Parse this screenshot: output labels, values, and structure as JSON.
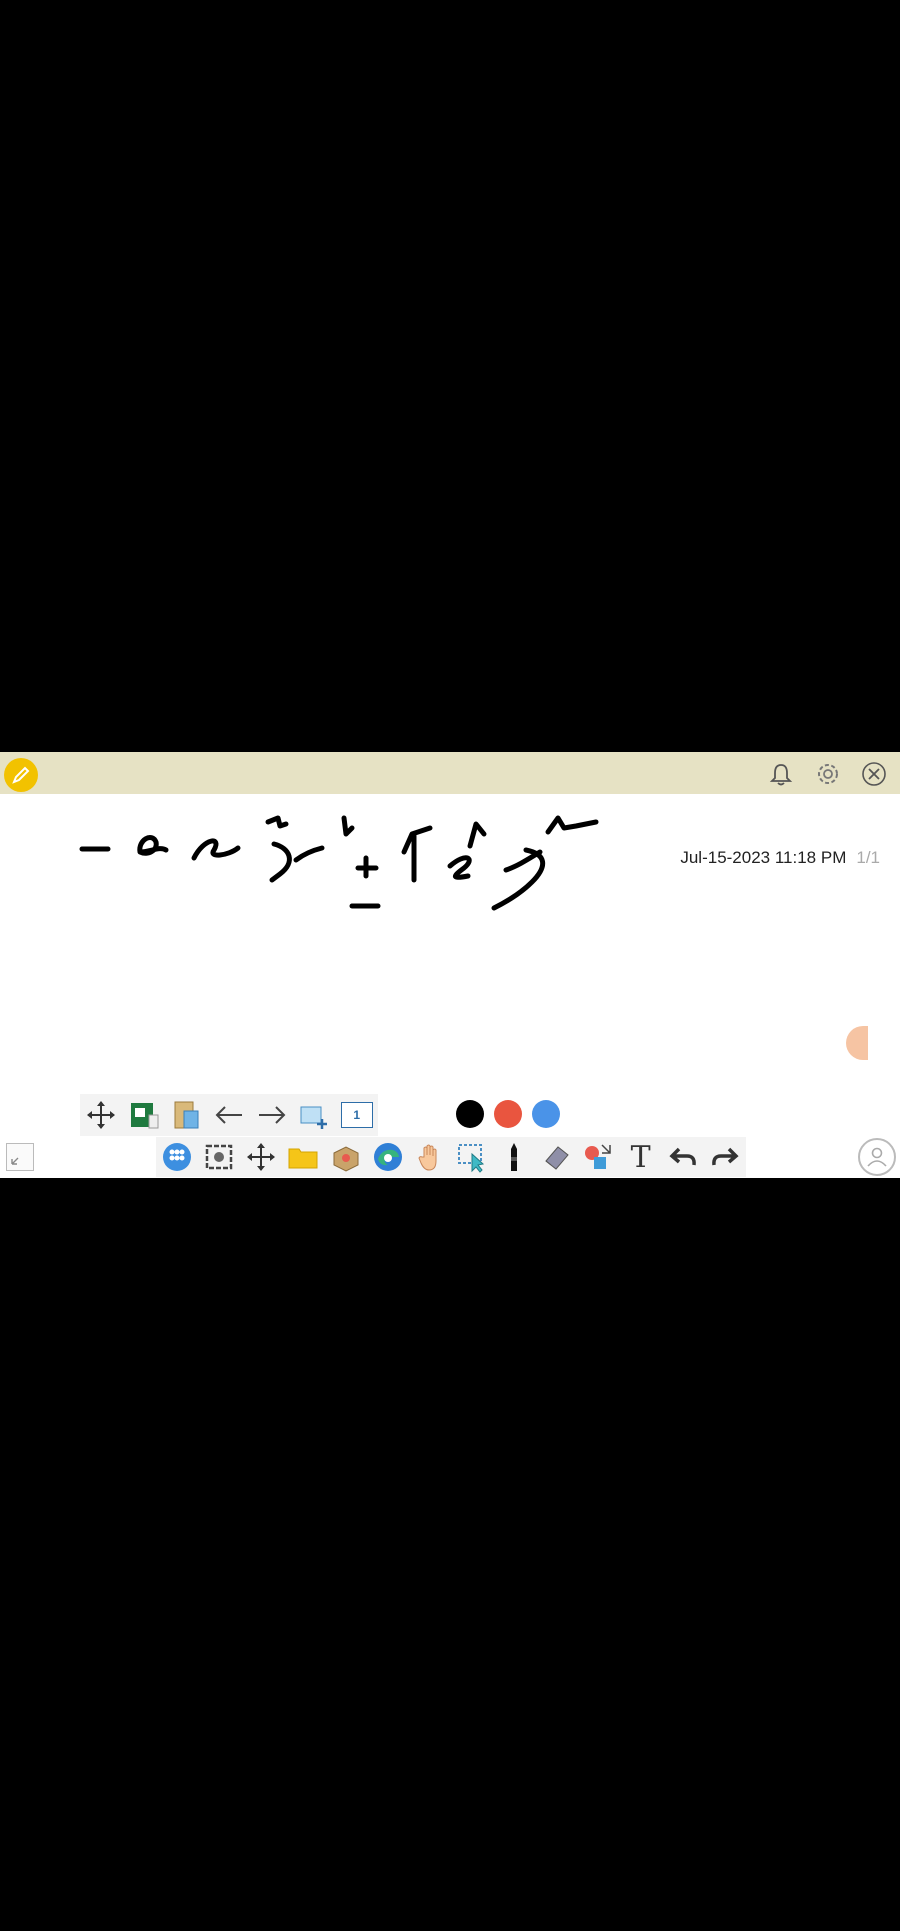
{
  "canvas": {
    "timestamp": "Jul-15-2023 11:18 PM",
    "page_indicator": "1/1"
  },
  "upper_dock": {
    "page_count": "1"
  },
  "lower_dock": {
    "text_tool_glyph": "T"
  },
  "colors": {
    "titlebar": "#e6e2c4",
    "pen_badge": "#f2c200",
    "palette": [
      "#000000",
      "#e9553f",
      "#4a93e8"
    ]
  },
  "icons": {
    "titlebar": [
      "pen-icon",
      "bell-icon",
      "gear-icon",
      "close-icon"
    ],
    "upper_dock": [
      "move-icon",
      "whiteboard-icon",
      "clipboard-icon",
      "arrow-left-icon",
      "arrow-right-icon",
      "new-page-icon",
      "page-number-icon"
    ],
    "lower_dock": [
      "apps-icon",
      "screenshot-icon",
      "move-icon",
      "folder-icon",
      "toolbox-icon",
      "browser-icon",
      "hand-icon",
      "selection-icon",
      "marker-icon",
      "eraser-icon",
      "shapes-icon",
      "text-icon",
      "undo-icon",
      "redo-icon"
    ],
    "corners": [
      "shrink-icon",
      "user-icon"
    ]
  }
}
